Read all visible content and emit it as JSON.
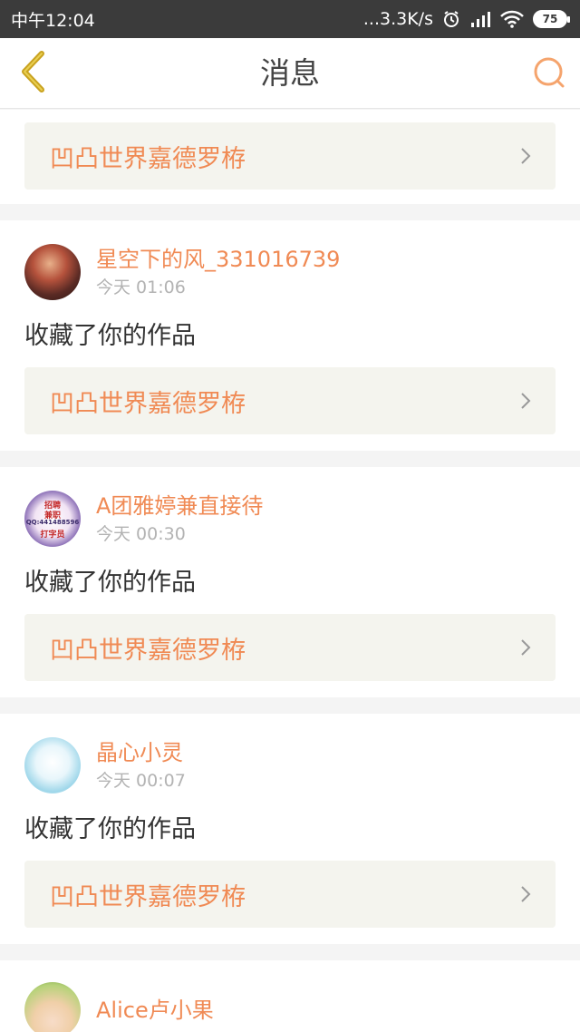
{
  "status_bar": {
    "time": "中午12:04",
    "network_speed": "...3.3K/s",
    "battery": "75",
    "icons": [
      "alarm-icon",
      "signal-icon",
      "wifi-icon",
      "battery-icon"
    ]
  },
  "header": {
    "title": "消息",
    "back_icon": "chevron-left-icon",
    "search_icon": "search-icon"
  },
  "colors": {
    "accent": "#f08a54",
    "back_icon": "#c9a21f",
    "text_primary": "#333333",
    "text_secondary": "#b3b3b3",
    "card_link_bg": "#f4f4ee",
    "status_bar_bg": "#3b3b3b"
  },
  "feed": {
    "top_card": {
      "work_title": "凹凸世界嘉德罗栫"
    },
    "messages": [
      {
        "user_name": "星空下的风_331016739",
        "time": "今天 01:06",
        "action": "收藏了你的作品",
        "work_title": "凹凸世界嘉德罗栫"
      },
      {
        "user_name": "A团雅婷兼直接待",
        "time": "今天 00:30",
        "action": "收藏了你的作品",
        "work_title": "凹凸世界嘉德罗栫",
        "avatar_text": [
          "招聘",
          "兼职",
          "QQ:441488596",
          "打字员"
        ]
      },
      {
        "user_name": "晶心小灵",
        "time": "今天 00:07",
        "action": "收藏了你的作品",
        "work_title": "凹凸世界嘉德罗栫"
      },
      {
        "user_name": "Alice卢小果"
      }
    ]
  }
}
